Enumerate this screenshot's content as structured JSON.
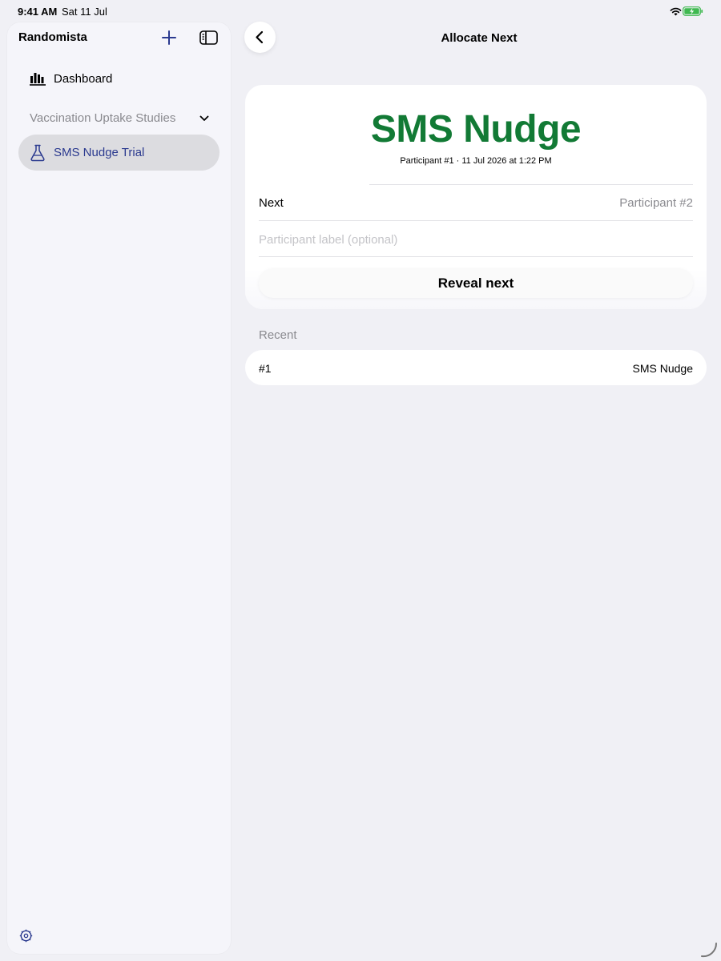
{
  "status_bar": {
    "time": "9:41 AM",
    "date": "Sat 11 Jul"
  },
  "sidebar": {
    "title": "Randomista",
    "dashboard_label": "Dashboard",
    "section_label": "Vaccination Uptake Studies",
    "selected_item_label": "SMS Nudge Trial"
  },
  "nav": {
    "title": "Allocate Next"
  },
  "allocation": {
    "arm_name": "SMS Nudge",
    "meta": "Participant #1 · 11 Jul 2026 at 1:22 PM",
    "next_label": "Next",
    "next_value": "Participant #2",
    "label_placeholder": "Participant label (optional)",
    "label_value": "",
    "reveal_label": "Reveal next"
  },
  "recent": {
    "header": "Recent",
    "rows": [
      {
        "id": "#1",
        "arm": "SMS Nudge"
      }
    ]
  },
  "colors": {
    "accent": "#2b3a8f",
    "arm_green": "#127a35",
    "secondary_text": "#8a8a8f",
    "background": "#f0f0f5"
  },
  "icons": {
    "wifi": "wifi-icon",
    "battery": "battery-charging-icon",
    "add": "plus-icon",
    "sidebar_toggle": "sidebar-toggle-icon",
    "dashboard": "bar-chart-icon",
    "section_chevron": "chevron-down-icon",
    "trial": "flask-icon",
    "settings": "gear-icon",
    "back": "chevron-left-icon"
  }
}
